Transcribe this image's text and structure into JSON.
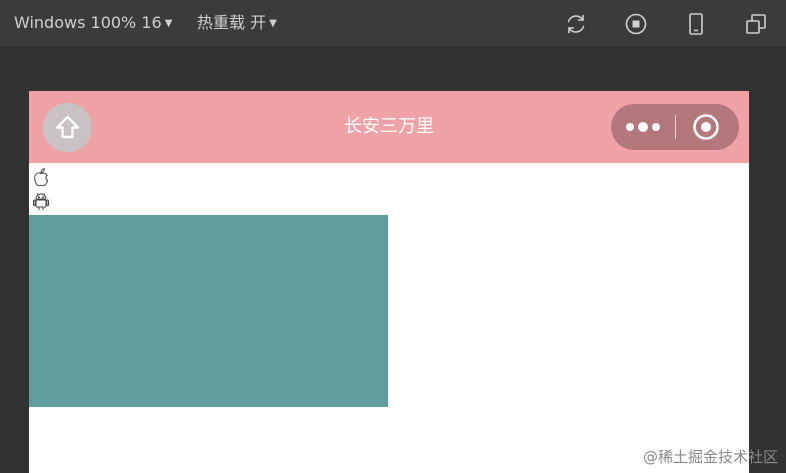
{
  "toolbar": {
    "device_label": "Windows 100% 16",
    "hot_reload_label": "热重载 开",
    "icons": [
      "refresh-icon",
      "stop-icon",
      "phone-icon",
      "windows-icon"
    ]
  },
  "navbar": {
    "title": "长安三万里",
    "background": "#f0a3a7",
    "icons": [
      "home-icon",
      "more-dots-icon",
      "target-icon"
    ]
  },
  "content": {
    "icons": [
      "apple-icon",
      "android-icon"
    ],
    "box_color": "#5f9e9d"
  },
  "watermark": "@稀土掘金技术社区"
}
